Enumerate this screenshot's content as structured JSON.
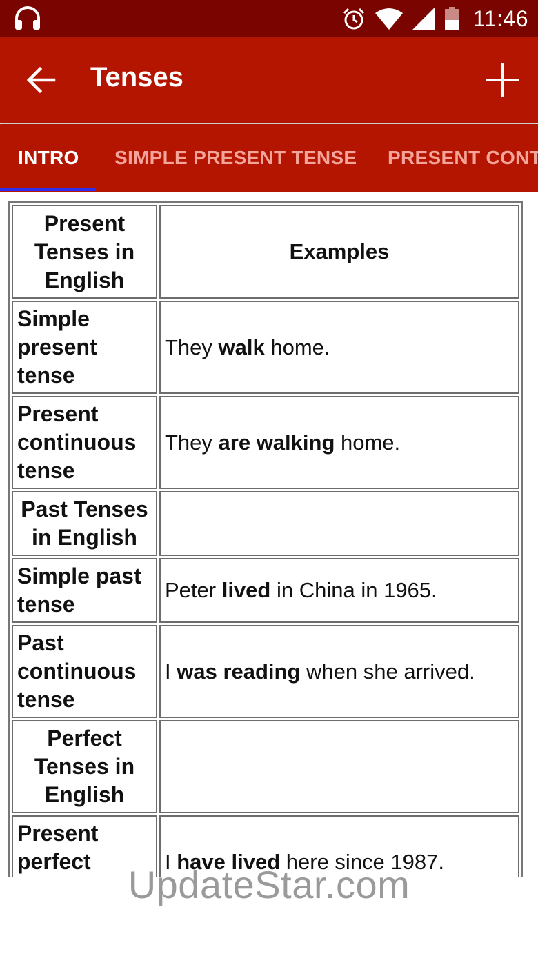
{
  "status_bar": {
    "time": "11:46",
    "icons": [
      "headphones-icon",
      "alarm-icon",
      "wifi-icon",
      "signal-icon",
      "battery-icon"
    ]
  },
  "app_bar": {
    "title": "Tenses",
    "back_icon": "arrow-left-icon",
    "add_icon": "plus-icon"
  },
  "tabs": [
    {
      "label": "INTRO",
      "active": true
    },
    {
      "label": "SIMPLE PRESENT TENSE",
      "active": false
    },
    {
      "label": "PRESENT CONT",
      "active": false
    }
  ],
  "table": {
    "rows": [
      {
        "col1": "Present Tenses in English",
        "header": true,
        "col2": [
          {
            "text": "Examples",
            "bold": true
          }
        ]
      },
      {
        "col1": "Simple present tense",
        "header": false,
        "col2": [
          {
            "text": "They ",
            "bold": false
          },
          {
            "text": "walk",
            "bold": true
          },
          {
            "text": " home.",
            "bold": false
          }
        ]
      },
      {
        "col1": "Present continuous tense",
        "header": false,
        "col2": [
          {
            "text": "They ",
            "bold": false
          },
          {
            "text": "are walking",
            "bold": true
          },
          {
            "text": " home.",
            "bold": false
          }
        ]
      },
      {
        "col1": "Past Tenses in English",
        "header": true,
        "col2": []
      },
      {
        "col1": "Simple past tense",
        "header": false,
        "col2": [
          {
            "text": "Peter ",
            "bold": false
          },
          {
            "text": "lived",
            "bold": true
          },
          {
            "text": " in China in 1965.",
            "bold": false
          }
        ]
      },
      {
        "col1": "Past continuous tense",
        "header": false,
        "col2": [
          {
            "text": "I ",
            "bold": false
          },
          {
            "text": "was reading",
            "bold": true
          },
          {
            "text": " when she arrived.",
            "bold": false
          }
        ]
      },
      {
        "col1": "Perfect Tenses in English",
        "header": true,
        "col2": []
      },
      {
        "col1": "Present perfect tense",
        "header": false,
        "col2": [
          {
            "text": "I ",
            "bold": false
          },
          {
            "text": "have lived",
            "bold": true
          },
          {
            "text": " here since 1987.",
            "bold": false
          }
        ]
      }
    ]
  },
  "watermark": "UpdateStar.com",
  "colors": {
    "status_bar": "#7a0500",
    "app_bar": "#b41500",
    "tab_active_text": "#ffffff",
    "tab_inactive_text": "#f4a49a",
    "tab_indicator": "#2f2ff0"
  }
}
